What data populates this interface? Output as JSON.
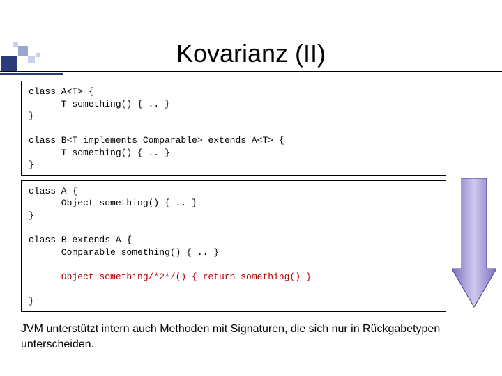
{
  "title": "Kovarianz (II)",
  "code1": {
    "l1": "class A<T> {",
    "l2": "      T something() { .. }",
    "l3": "}",
    "l4": "",
    "l5": "class B<T implements Comparable> extends A<T> {",
    "l6": "      T something() { .. }",
    "l7": "}"
  },
  "code2": {
    "l1": "class A {",
    "l2": "      Object something() { .. }",
    "l3": "}",
    "l4": "",
    "l5": "class B extends A {",
    "l6": "      Comparable something() { .. }",
    "l7": "",
    "l8": "      Object something/*2*/() { return something() }",
    "l9": "",
    "l10": "}"
  },
  "caption": "JVM unterstützt intern auch Methoden mit Signaturen, die sich nur in Rückgabetypen unterscheiden."
}
